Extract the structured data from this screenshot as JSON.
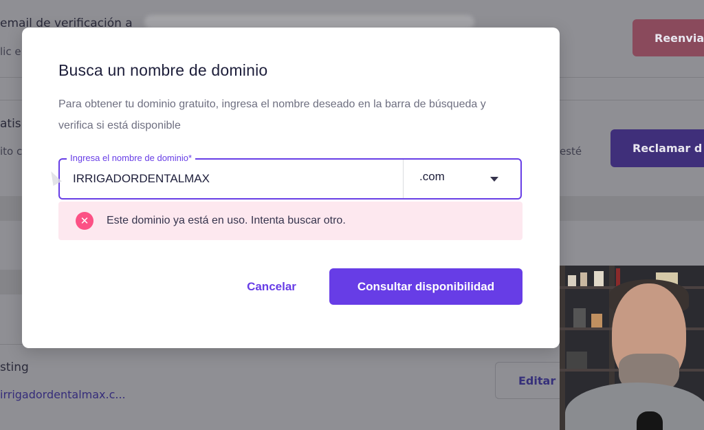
{
  "background": {
    "email_heading": "email de verificación a",
    "email_sub": "lic e",
    "resend_button": "Reenviar",
    "free_heading": "atis",
    "free_sub": "ito c",
    "free_right_sub": "esté",
    "claim_button": "Reclamar d",
    "hosting_heading": "sting",
    "hosting_link": "irrigadordentalmax.c...",
    "edit_button": "Editar s"
  },
  "modal": {
    "title": "Busca un nombre de dominio",
    "description": "Para obtener tu dominio gratuito, ingresa el nombre deseado en la barra de búsqueda y verifica si está disponible",
    "field_label": "Ingresa el nombre de dominio*",
    "domain_value": "IRRIGADORDENTALMAX",
    "tld_selected": ".com",
    "error_message": "Este dominio ya está en uso. Intenta buscar otro.",
    "cancel_label": "Cancelar",
    "submit_label": "Consultar disponibilidad"
  },
  "colors": {
    "accent": "#673de6",
    "error_bg": "#fde8ef",
    "error_icon": "#fc5185"
  },
  "icons": {
    "error": "error-x-icon",
    "dropdown": "chevron-down-icon",
    "cursor": "mouse-pointer-icon"
  }
}
